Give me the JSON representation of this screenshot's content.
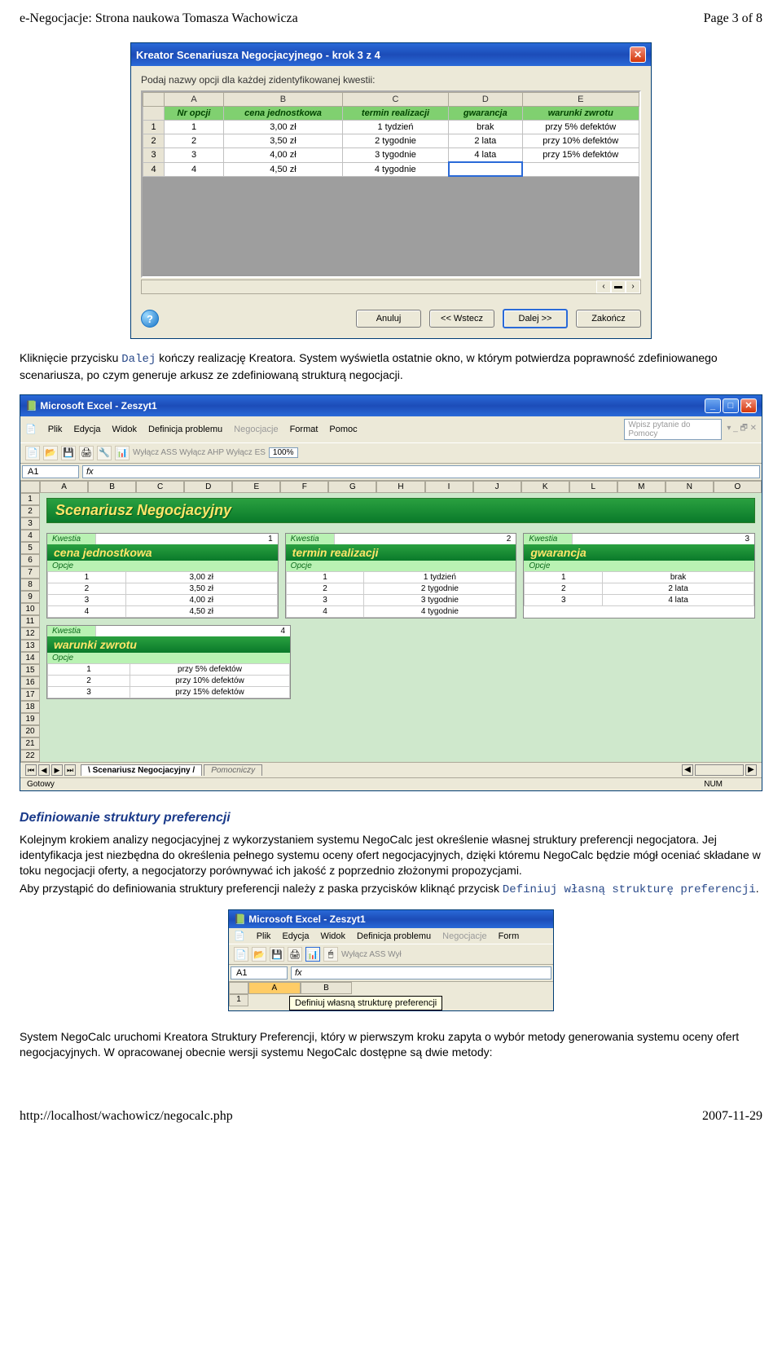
{
  "header": {
    "left": "e-Negocjacje: Strona naukowa Tomasza Wachowicza",
    "right": "Page 3 of 8"
  },
  "footer": {
    "left": "http://localhost/wachowicz/negocalc.php",
    "right": "2007-11-29"
  },
  "dialog": {
    "title": "Kreator Scenariusza Negocjacyjnego - krok 3 z 4",
    "prompt": "Podaj nazwy opcji dla każdej zidentyfikowanej kwestii:",
    "colLetters": [
      "A",
      "B",
      "C",
      "D",
      "E"
    ],
    "headers": [
      "Nr opcji",
      "cena jednostkowa",
      "termin realizacji",
      "gwarancja",
      "warunki zwrotu"
    ],
    "rows": [
      [
        "1",
        "3,00 zł",
        "1 tydzień",
        "brak",
        "przy 5% defektów"
      ],
      [
        "2",
        "3,50 zł",
        "2 tygodnie",
        "2 lata",
        "przy 10% defektów"
      ],
      [
        "3",
        "4,00 zł",
        "3 tygodnie",
        "4 lata",
        "przy 15% defektów"
      ],
      [
        "4",
        "4,50 zł",
        "4 tygodnie",
        "",
        ""
      ]
    ],
    "buttons": {
      "cancel": "Anuluj",
      "back": "<< Wstecz",
      "next": "Dalej >>",
      "finish": "Zakończ"
    }
  },
  "para1": {
    "a": "Kliknięcie przycisku ",
    "code": "Dalej",
    "b": " kończy realizację Kreatora. System wyświetla ostatnie okno, w którym potwierdza poprawność zdefiniowanego scenariusza, po czym generuje arkusz ze zdefiniowaną strukturą negocjacji."
  },
  "excel1": {
    "title": "Microsoft Excel - Zeszyt1",
    "menus": [
      "Plik",
      "Edycja",
      "Widok",
      "Definicja problemu",
      "Negocjacje",
      "Format",
      "Pomoc"
    ],
    "searchHint": "Wpisz pytanie do Pomocy",
    "toolbarText": "Wyłącz ASS  Wyłącz AHP  Wyłącz ES",
    "zoom": "100%",
    "nameBox": "A1",
    "cols": [
      "A",
      "B",
      "C",
      "D",
      "E",
      "F",
      "G",
      "H",
      "I",
      "J",
      "K",
      "L",
      "M",
      "N",
      "O"
    ],
    "rowCount": 22,
    "bigTitle": "Scenariusz Negocjacyjny",
    "kwLabel": "Kwestia",
    "opcjeLabel": "Opcje",
    "kw": [
      {
        "num": "1",
        "name": "cena jednostkowa",
        "rows": [
          [
            "1",
            "3,00 zł"
          ],
          [
            "2",
            "3,50 zł"
          ],
          [
            "3",
            "4,00 zł"
          ],
          [
            "4",
            "4,50 zł"
          ]
        ]
      },
      {
        "num": "2",
        "name": "termin realizacji",
        "rows": [
          [
            "1",
            "1 tydzień"
          ],
          [
            "2",
            "2 tygodnie"
          ],
          [
            "3",
            "3 tygodnie"
          ],
          [
            "4",
            "4 tygodnie"
          ]
        ]
      },
      {
        "num": "3",
        "name": "gwarancja",
        "rows": [
          [
            "1",
            "brak"
          ],
          [
            "2",
            "2 lata"
          ],
          [
            "3",
            "4 lata"
          ]
        ]
      },
      {
        "num": "4",
        "name": "warunki zwrotu",
        "rows": [
          [
            "1",
            "przy 5% defektów"
          ],
          [
            "2",
            "przy 10% defektów"
          ],
          [
            "3",
            "przy 15% defektów"
          ]
        ]
      }
    ],
    "tabActive": "Scenariusz Negocjacyjny",
    "tabInactive": "Pomocniczy",
    "statusLeft": "Gotowy",
    "statusRight": "NUM"
  },
  "section2": {
    "title": "Definiowanie struktury preferencji"
  },
  "para2": "Kolejnym krokiem analizy negocjacyjnej z wykorzystaniem systemu NegoCalc jest określenie własnej struktury preferencji negocjatora. Jej identyfikacja jest niezbędna do określenia pełnego systemu oceny ofert negocjacyjnych, dzięki któremu NegoCalc będzie mógł oceniać składane w toku negocjacji oferty, a negocjatorzy porównywać ich jakość z poprzednio złożonymi propozycjami.",
  "para2b": {
    "a": "Aby przystąpić do definiowania struktury preferencji należy z paska przycisków kliknąć przycisk ",
    "code": "Definiuj własną strukturę preferencji",
    "b": "."
  },
  "excel2": {
    "title": "Microsoft Excel - Zeszyt1",
    "menus": [
      "Plik",
      "Edycja",
      "Widok",
      "Definicja problemu",
      "Negocjacje",
      "Form"
    ],
    "toolbarTail": "Wyłącz ASS  Wył",
    "nameBox": "A1",
    "cols": [
      "A",
      "B"
    ],
    "tooltip": "Definiuj własną strukturę preferencji"
  },
  "para3": "System NegoCalc uruchomi Kreatora Struktury Preferencji, który w pierwszym kroku zapyta o wybór metody generowania systemu oceny ofert negocjacyjnych. W opracowanej obecnie wersji systemu NegoCalc dostępne są dwie metody:"
}
